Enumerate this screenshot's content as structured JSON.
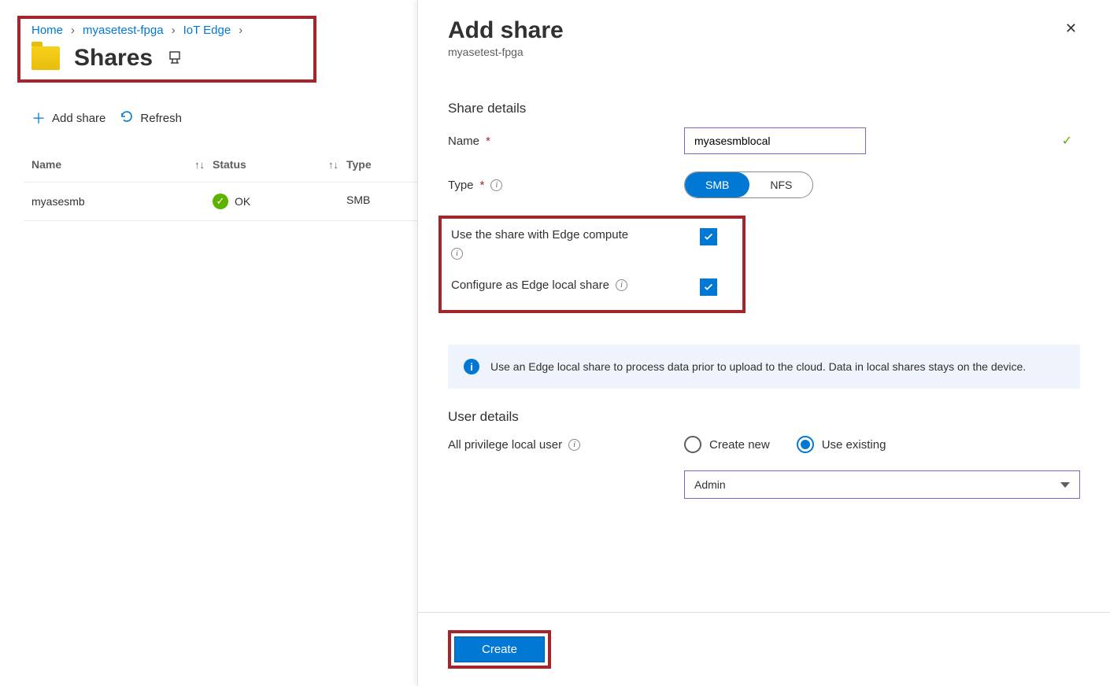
{
  "breadcrumb": {
    "home": "Home",
    "resource": "myasetest-fpga",
    "section": "IoT Edge"
  },
  "page": {
    "title": "Shares"
  },
  "toolbar": {
    "add": "Add share",
    "refresh": "Refresh"
  },
  "columns": {
    "name": "Name",
    "status": "Status",
    "type": "Type"
  },
  "rows": [
    {
      "name": "myasesmb",
      "status": "OK",
      "type": "SMB"
    }
  ],
  "panel": {
    "title": "Add share",
    "subtitle": "myasetest-fpga",
    "share_details_heading": "Share details",
    "name_label": "Name",
    "name_value": "myasesmblocal",
    "type_label": "Type",
    "type_options": {
      "smb": "SMB",
      "nfs": "NFS"
    },
    "edge_compute_label": "Use the share with Edge compute",
    "local_share_label": "Configure as Edge local share",
    "info_banner": "Use an Edge local share to process data prior to upload to the cloud. Data in local shares stays on the device.",
    "user_details_heading": "User details",
    "user_label": "All privilege local user",
    "radio": {
      "create": "Create new",
      "existing": "Use existing"
    },
    "user_select": "Admin",
    "create_button": "Create"
  }
}
